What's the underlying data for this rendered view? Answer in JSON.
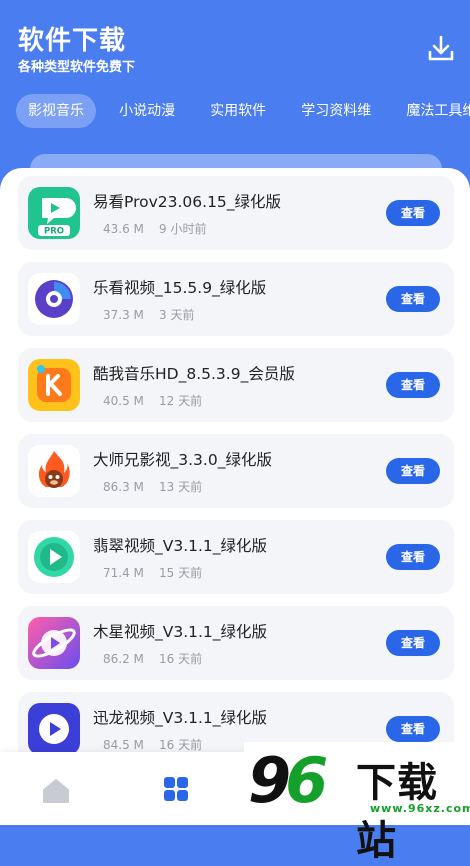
{
  "header": {
    "title": "软件下载",
    "subtitle": "各种类型软件免费下",
    "download_icon": "download-icon"
  },
  "tabs": [
    {
      "label": "影视音乐",
      "active": true
    },
    {
      "label": "小说动漫",
      "active": false
    },
    {
      "label": "实用软件",
      "active": false
    },
    {
      "label": "学习资料维",
      "active": false
    },
    {
      "label": "魔法工具维",
      "active": false
    }
  ],
  "apps": [
    {
      "name": "易看Prov23.06.15_绿化版",
      "size": "43.6 M",
      "time": "9 小时前",
      "button": "查看",
      "icon": "yikan-icon",
      "icon_label": "PRO"
    },
    {
      "name": "乐看视频_15.5.9_绿化版",
      "size": "37.3 M",
      "time": "3 天前",
      "button": "查看",
      "icon": "lekan-icon"
    },
    {
      "name": "酷我音乐HD_8.5.3.9_会员版",
      "size": "40.5 M",
      "time": "12 天前",
      "button": "查看",
      "icon": "kuwo-icon"
    },
    {
      "name": "大师兄影视_3.3.0_绿化版",
      "size": "86.3 M",
      "time": "13 天前",
      "button": "查看",
      "icon": "dashixiong-icon"
    },
    {
      "name": "翡翠视频_V3.1.1_绿化版",
      "size": "71.4 M",
      "time": "15 天前",
      "button": "查看",
      "icon": "feicui-icon"
    },
    {
      "name": "木星视频_V3.1.1_绿化版",
      "size": "86.2 M",
      "time": "16 天前",
      "button": "查看",
      "icon": "muxing-icon"
    },
    {
      "name": "迅龙视频_V3.1.1_绿化版",
      "size": "84.5 M",
      "time": "16 天前",
      "button": "查看",
      "icon": "xunlong-icon"
    }
  ],
  "bottom_nav": {
    "items": [
      {
        "icon": "home-icon",
        "active": false
      },
      {
        "icon": "grid-icon",
        "active": true
      }
    ]
  },
  "watermark": {
    "digits": "9",
    "digit_six": "6",
    "text": "下载站",
    "url": "www.96xz.com"
  },
  "colors": {
    "brand_blue": "#4a7df0",
    "button_blue": "#2a66e8",
    "card_bg": "#f4f5f8"
  }
}
